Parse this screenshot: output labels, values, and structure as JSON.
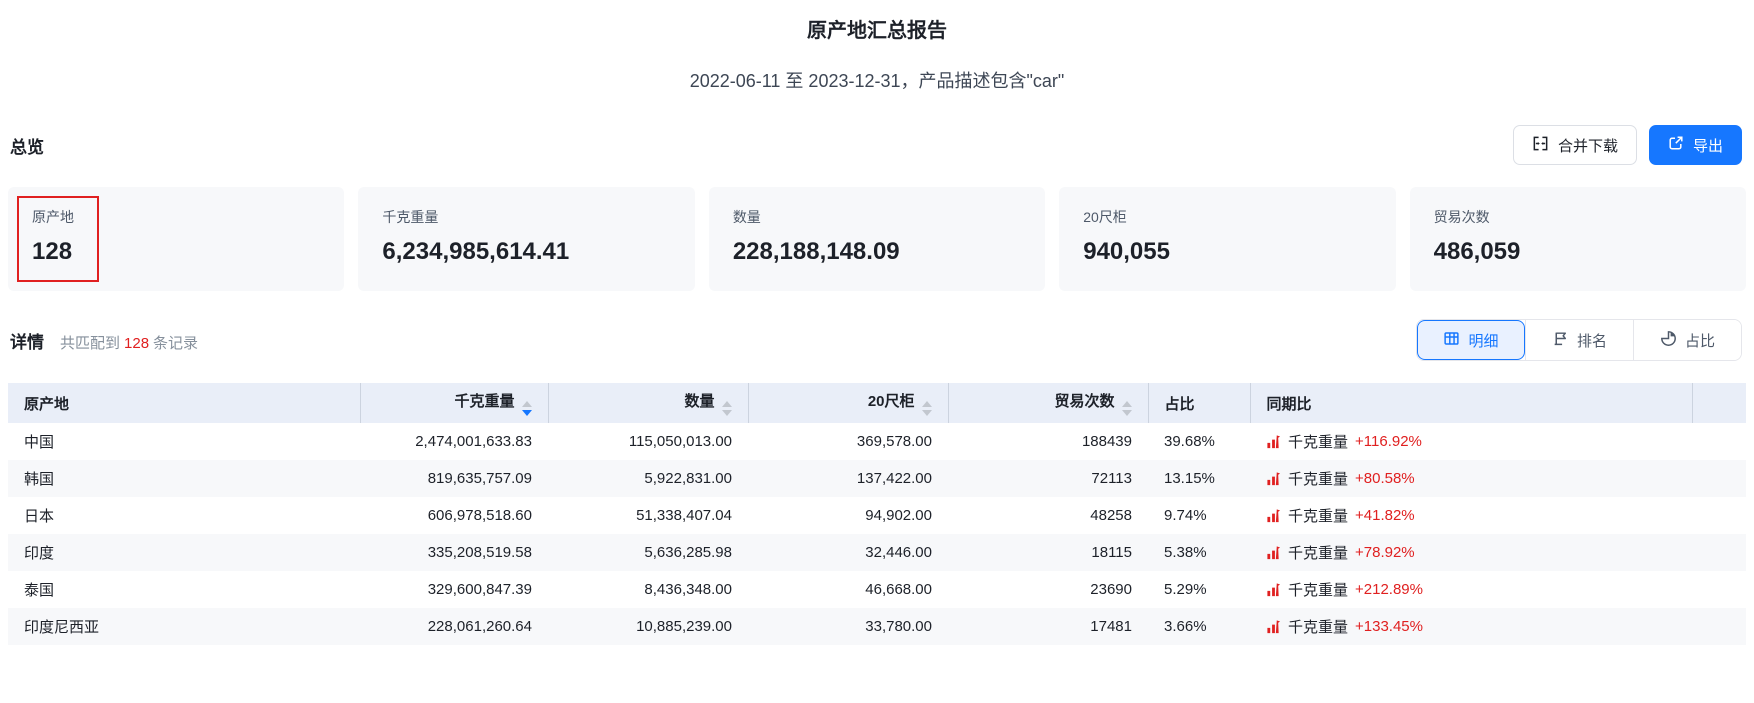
{
  "page": {
    "title": "原产地汇总报告",
    "subtitle": "2022-06-11 至 2023-12-31，产品描述包含\"car\""
  },
  "overview": {
    "heading": "总览",
    "merge_download_label": "合并下载",
    "export_label": "导出",
    "cards": [
      {
        "label": "原产地",
        "value": "128",
        "highlighted": true
      },
      {
        "label": "千克重量",
        "value": "6,234,985,614.41",
        "highlighted": false
      },
      {
        "label": "数量",
        "value": "228,188,148.09",
        "highlighted": false
      },
      {
        "label": "20尺柜",
        "value": "940,055",
        "highlighted": false
      },
      {
        "label": "贸易次数",
        "value": "486,059",
        "highlighted": false
      }
    ]
  },
  "detail": {
    "heading": "详情",
    "match_prefix": "共匹配到",
    "match_count": "128",
    "match_suffix": "条记录",
    "tabs": [
      {
        "label": "明细",
        "icon": "table-icon",
        "active": true
      },
      {
        "label": "排名",
        "icon": "ranking-icon",
        "active": false
      },
      {
        "label": "占比",
        "icon": "pie-icon",
        "active": false
      }
    ]
  },
  "table": {
    "columns": [
      {
        "label": "原产地",
        "align": "left",
        "sortable": false,
        "sort": null
      },
      {
        "label": "千克重量",
        "align": "right",
        "sortable": true,
        "sort": "desc"
      },
      {
        "label": "数量",
        "align": "right",
        "sortable": true,
        "sort": null
      },
      {
        "label": "20尺柜",
        "align": "right",
        "sortable": true,
        "sort": null
      },
      {
        "label": "贸易次数",
        "align": "right",
        "sortable": true,
        "sort": null
      },
      {
        "label": "占比",
        "align": "left",
        "sortable": false,
        "sort": null
      },
      {
        "label": "同期比",
        "align": "left",
        "sortable": false,
        "sort": null
      },
      {
        "label": "",
        "align": "left",
        "sortable": false,
        "sort": null
      }
    ],
    "rows": [
      {
        "origin": "中国",
        "kg": "2,474,001,633.83",
        "qty": "115,050,013.00",
        "teu": "369,578.00",
        "trades": "188439",
        "share": "39.68%",
        "yoy_label": "千克重量",
        "yoy_value": "+116.92%"
      },
      {
        "origin": "韩国",
        "kg": "819,635,757.09",
        "qty": "5,922,831.00",
        "teu": "137,422.00",
        "trades": "72113",
        "share": "13.15%",
        "yoy_label": "千克重量",
        "yoy_value": "+80.58%"
      },
      {
        "origin": "日本",
        "kg": "606,978,518.60",
        "qty": "51,338,407.04",
        "teu": "94,902.00",
        "trades": "48258",
        "share": "9.74%",
        "yoy_label": "千克重量",
        "yoy_value": "+41.82%"
      },
      {
        "origin": "印度",
        "kg": "335,208,519.58",
        "qty": "5,636,285.98",
        "teu": "32,446.00",
        "trades": "18115",
        "share": "5.38%",
        "yoy_label": "千克重量",
        "yoy_value": "+78.92%"
      },
      {
        "origin": "泰国",
        "kg": "329,600,847.39",
        "qty": "8,436,348.00",
        "teu": "46,668.00",
        "trades": "23690",
        "share": "5.29%",
        "yoy_label": "千克重量",
        "yoy_value": "+212.89%"
      },
      {
        "origin": "印度尼西亚",
        "kg": "228,061,260.64",
        "qty": "10,885,239.00",
        "teu": "33,780.00",
        "trades": "17481",
        "share": "3.66%",
        "yoy_label": "千克重量",
        "yoy_value": "+133.45%"
      }
    ]
  },
  "icons": {
    "merge_button_icon": "merge-cells-icon",
    "export_button_icon": "export-icon",
    "active_tab_icon": "table-icon",
    "rank_tab_icon": "ranking-icon",
    "share_tab_icon": "pie-icon",
    "yoy_icon": "trend-bars-icon",
    "sort_icon": "sort-carets-icon"
  },
  "colors": {
    "accent_blue": "#1677ff",
    "alert_red": "#e02020",
    "table_header_bg": "#e9eef8",
    "card_bg": "#f7f8fa",
    "active_tab_bg": "#e9f1ff"
  }
}
